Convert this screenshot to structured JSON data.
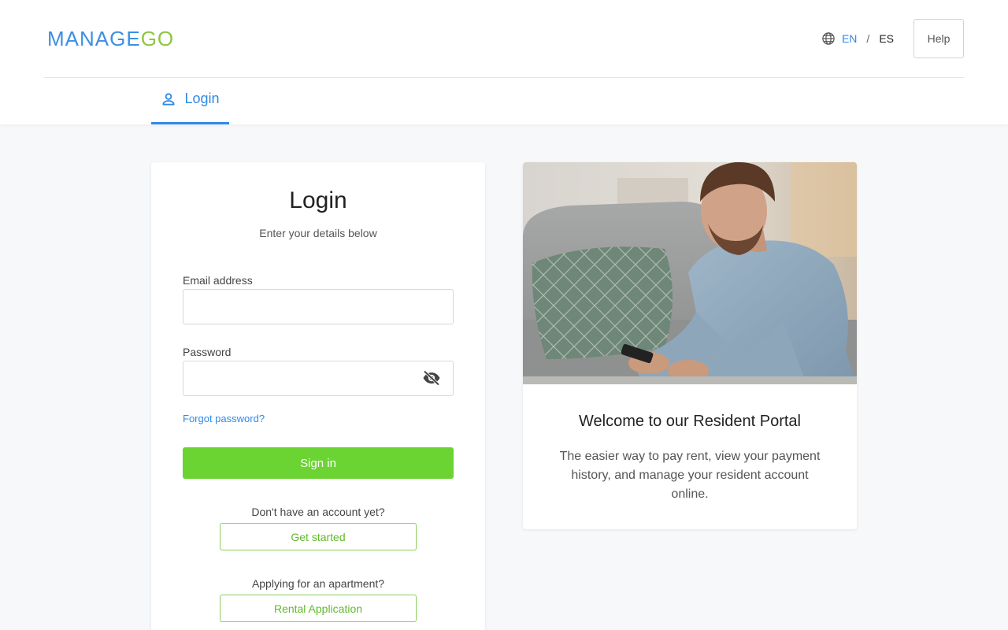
{
  "header": {
    "logo": {
      "part1": "MANAGE",
      "part2": "GO"
    },
    "languages": {
      "en": "EN",
      "separator": "/",
      "es": "ES"
    },
    "help_label": "Help",
    "tab_label": "Login"
  },
  "login": {
    "title": "Login",
    "subtitle": "Enter your details below",
    "email_label": "Email address",
    "email_value": "",
    "password_label": "Password",
    "password_value": "",
    "forgot_label": "Forgot password?",
    "signin_label": "Sign in",
    "no_account_text": "Don't have an account yet?",
    "get_started_label": "Get started",
    "applying_text": "Applying for an apartment?",
    "rental_label": "Rental Application"
  },
  "welcome": {
    "title": "Welcome to our Resident Portal",
    "text": "The easier way to pay rent, view your payment history, and manage your resident account online."
  },
  "colors": {
    "accent_blue": "#2f8ae6",
    "accent_green": "#6bd432",
    "logo_blue": "#3d8fe0",
    "logo_green": "#8cc63f"
  },
  "icons": {
    "language": "globe-icon",
    "tab": "user-icon",
    "password_toggle": "eye-off-icon"
  }
}
